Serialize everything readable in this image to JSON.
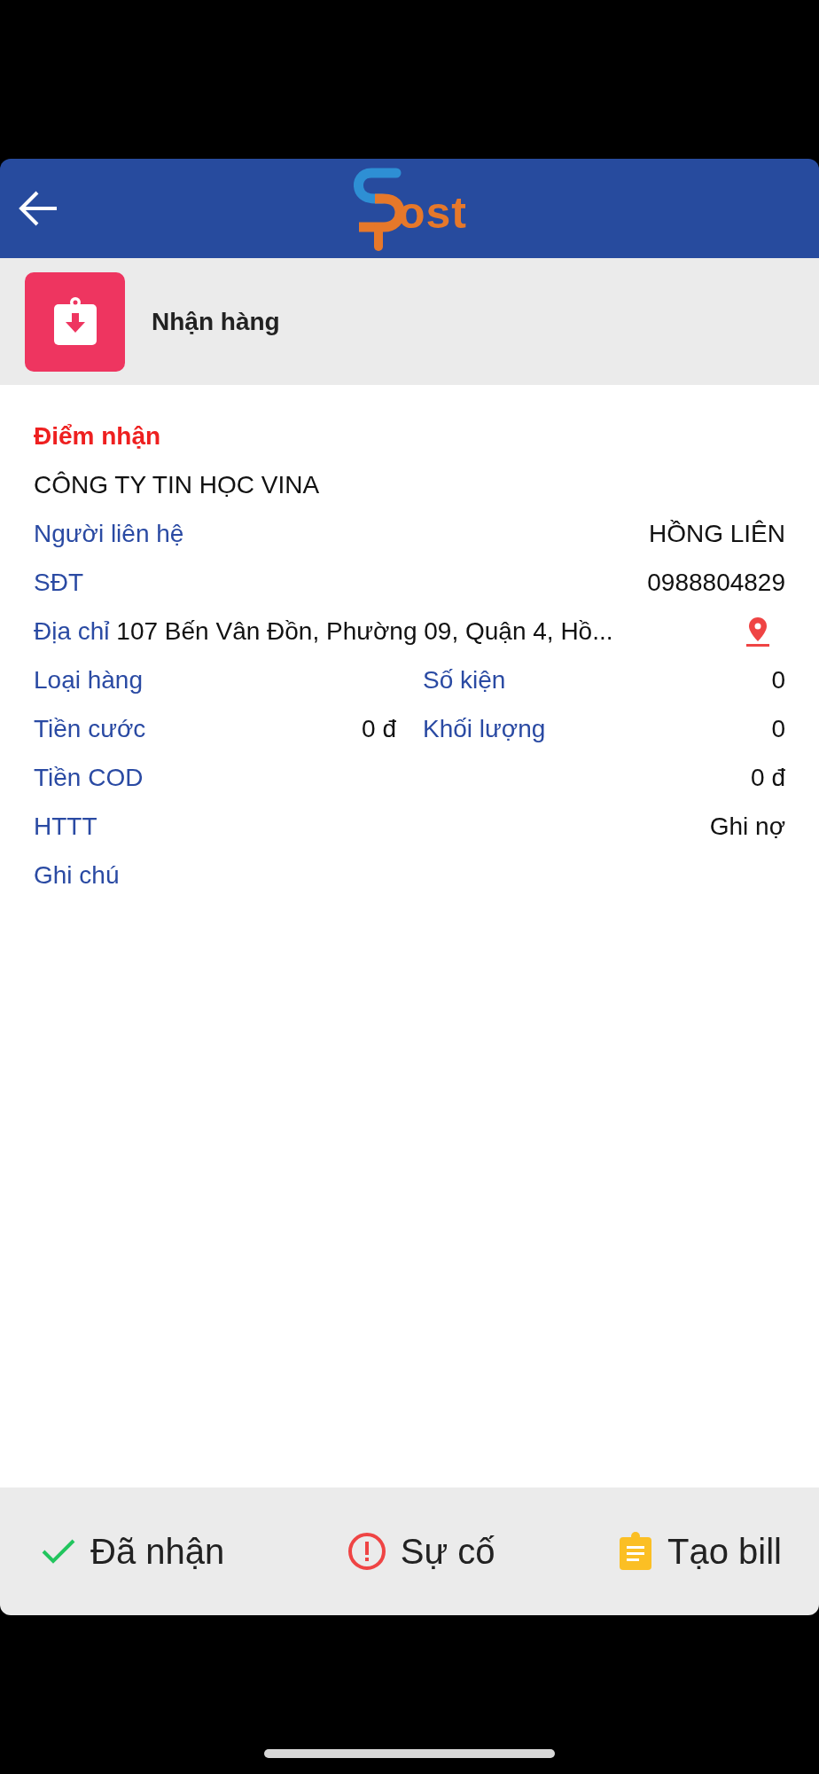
{
  "header": {
    "logo_text": "ost"
  },
  "section": {
    "title": "Nhận hàng"
  },
  "pickup": {
    "heading": "Điểm nhận",
    "company": "CÔNG TY TIN HỌC VINA"
  },
  "rows": [
    {
      "kind": "pair",
      "label": "Người liên hệ",
      "value": "HỒNG LIÊN"
    },
    {
      "kind": "pair",
      "label": "SĐT",
      "value": "0988804829"
    },
    {
      "kind": "address",
      "label": "Địa chỉ",
      "value": "107 Bến Vân Đồn, Phường 09, Quận 4, Hồ..."
    },
    {
      "kind": "double",
      "label": "Loại hàng",
      "label2": "Số kiện",
      "value2": "0"
    },
    {
      "kind": "double",
      "label": "Tiền cước",
      "value": "0 đ",
      "label2": "Khối lượng",
      "value2": "0"
    },
    {
      "kind": "pair",
      "label": "Tiền COD",
      "value": "0 đ"
    },
    {
      "kind": "pair",
      "label": "HTTT",
      "value": "Ghi nợ"
    },
    {
      "kind": "pair",
      "label": "Ghi chú"
    }
  ],
  "actions": [
    {
      "kind": "done",
      "label": "Đã nhận"
    },
    {
      "kind": "issue",
      "label": "Sự cố"
    },
    {
      "kind": "bill",
      "label": "Tạo bill"
    }
  ]
}
